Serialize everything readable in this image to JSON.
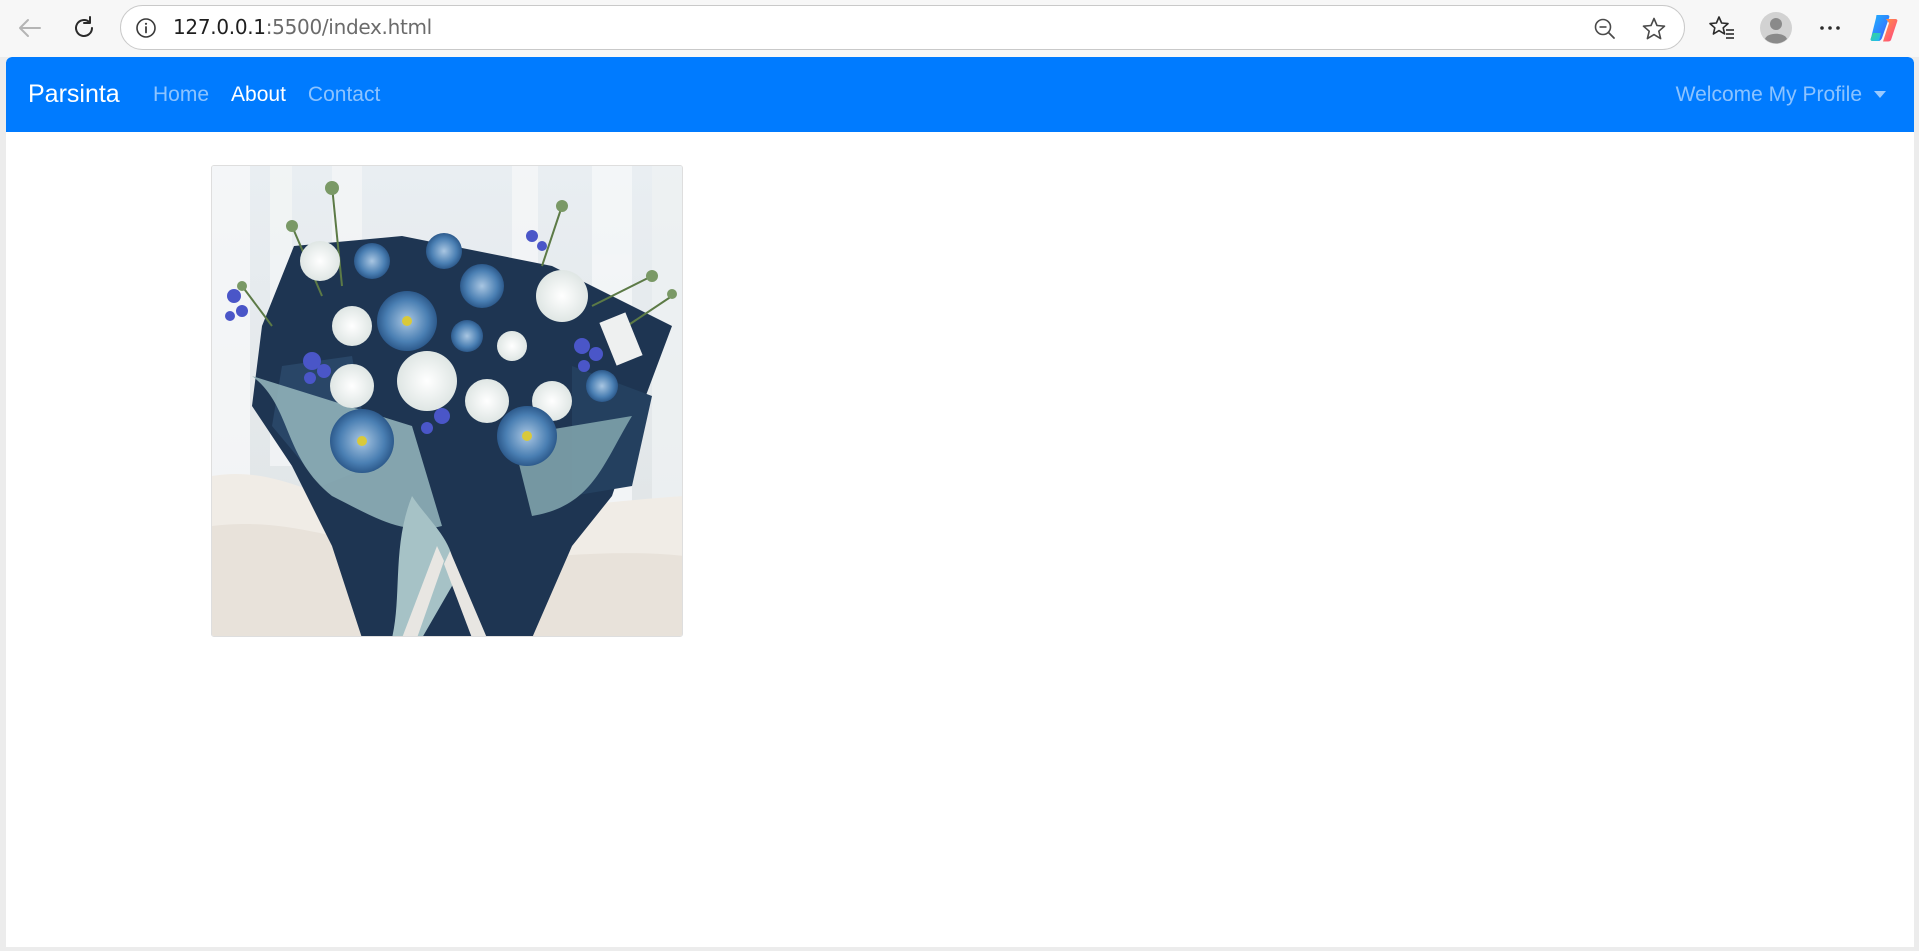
{
  "browser": {
    "url_host": "127.0.0.1",
    "url_rest": ":5500/index.html",
    "icons": [
      "back-arrow-icon",
      "reload-icon",
      "site-info-icon",
      "zoom-out-icon",
      "star-icon",
      "favorites-icon",
      "profile-avatar-icon",
      "more-icon",
      "copilot-icon"
    ]
  },
  "navbar": {
    "brand": "Parsinta",
    "links": [
      {
        "label": "Home",
        "active": false
      },
      {
        "label": "About",
        "active": true
      },
      {
        "label": "Contact",
        "active": false
      }
    ],
    "profile_label": "Welcome My Profile",
    "background_color": "#007bff"
  },
  "content": {
    "image": {
      "subject": "blue-and-white-flower-bouquet"
    }
  }
}
